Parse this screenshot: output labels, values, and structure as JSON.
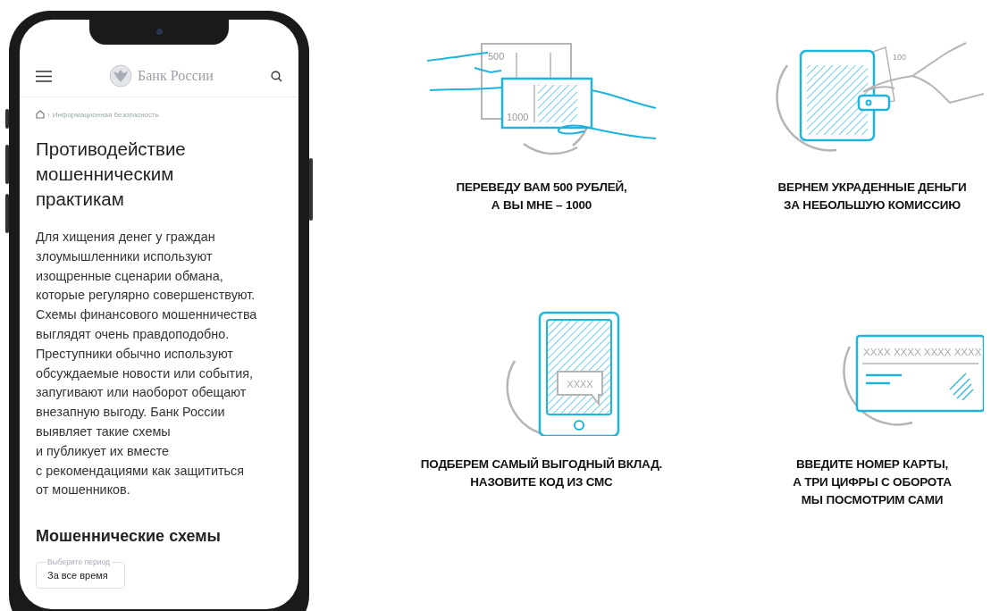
{
  "phone": {
    "header": {
      "logo_text": "Банк России"
    },
    "breadcrumb": {
      "separator": "›",
      "text": "Информационная безопасность"
    },
    "title": "Противодействие\nмошенническим\nпрактикам",
    "intro": "Для хищения денег у граждан\nзлоумышленники используют\nизощренные сценарии обмана,\nкоторые регулярно совершенствуют.\nСхемы финансового мошенничества\nвыглядят очень правдоподобно.\nПреступники обычно используют\nобсуждаемые новости или события,\nзапугивают или наоборот обещают\nвнезапную выгоду. Банк России\nвыявляет такие схемы\nи публикует их вместе\nс рекомендациями как защититься\nот мошенников.",
    "section_title": "Мошеннические схемы",
    "period_field": {
      "label": "Выберите период",
      "value": "За все время"
    }
  },
  "schemes": [
    {
      "kind": "banknotes",
      "labels": [
        "500",
        "1000"
      ],
      "caption": "ПЕРЕВЕДУ ВАМ 500 РУБЛЕЙ,\nА ВЫ МНЕ – 1000"
    },
    {
      "kind": "wallet",
      "labels": [
        "100"
      ],
      "caption": "ВЕРНЕМ УКРАДЕННЫЕ ДЕНЬГИ\nЗА НЕБОЛЬШУЮ КОМИССИЮ"
    },
    {
      "kind": "sms",
      "labels": [
        "XXXX"
      ],
      "caption": "ПОДБЕРЕМ САМЫЙ ВЫГОДНЫЙ ВКЛАД.\nНАЗОВИТЕ КОД ИЗ СМС"
    },
    {
      "kind": "card",
      "labels": [
        "XXXX XXXX XXXX XXXX"
      ],
      "caption": "ВВЕДИТЕ НОМЕР КАРТЫ,\nА ТРИ ЦИФРЫ С ОБОРОТА\nМЫ ПОСМОТРИМ САМИ"
    }
  ]
}
